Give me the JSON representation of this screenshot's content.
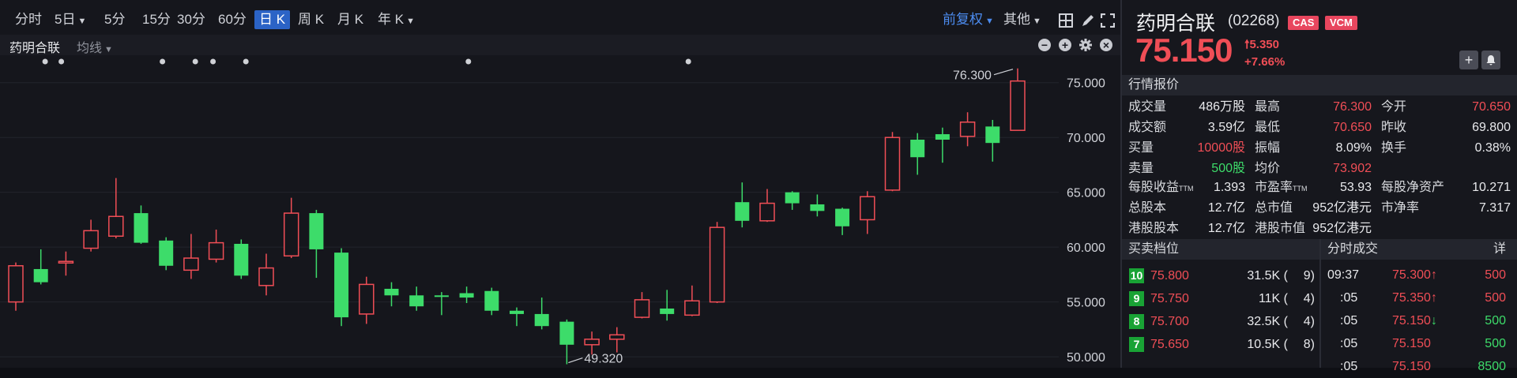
{
  "toolbar": {
    "periods": [
      {
        "label": "分时",
        "caret": false,
        "active": false
      },
      {
        "label": "5日",
        "caret": true,
        "active": false
      },
      {
        "label": "5分",
        "caret": false,
        "active": false
      },
      {
        "label": "15分",
        "caret": false,
        "active": false
      },
      {
        "label": "30分",
        "caret": false,
        "active": false
      },
      {
        "label": "60分",
        "caret": true,
        "active": false
      },
      {
        "label": "日 K",
        "caret": false,
        "active": true
      },
      {
        "label": "周 K",
        "caret": false,
        "active": false
      },
      {
        "label": "月 K",
        "caret": false,
        "active": false
      },
      {
        "label": "年 K",
        "caret": true,
        "active": false
      }
    ],
    "adjust_label": "前复权",
    "other_label": "其他"
  },
  "subbar": {
    "stock_label": "药明合联",
    "ma_label": "均线"
  },
  "chart_data": {
    "type": "candlestick",
    "y_ticks": [
      "75.000",
      "70.000",
      "65.000",
      "60.000",
      "55.000",
      "50.000"
    ],
    "ylim": [
      49.0,
      77.5
    ],
    "annotations": [
      {
        "text": "76.300",
        "value": 76.3
      },
      {
        "text": "49.320",
        "value": 49.32
      }
    ],
    "up_color": "#f04e56",
    "down_color": "#3ddc6a",
    "candles": [
      {
        "o": 55.0,
        "c": 58.3,
        "h": 58.6,
        "l": 54.2,
        "up": true
      },
      {
        "o": 58.0,
        "c": 56.8,
        "h": 59.8,
        "l": 56.6,
        "up": false
      },
      {
        "o": 58.6,
        "c": 58.7,
        "h": 59.6,
        "l": 57.4,
        "up": true
      },
      {
        "o": 59.9,
        "c": 61.5,
        "h": 62.5,
        "l": 59.6,
        "up": true
      },
      {
        "o": 61.0,
        "c": 62.8,
        "h": 66.3,
        "l": 60.8,
        "up": true
      },
      {
        "o": 63.1,
        "c": 60.4,
        "h": 63.8,
        "l": 60.3,
        "up": false
      },
      {
        "o": 60.6,
        "c": 58.3,
        "h": 60.9,
        "l": 57.9,
        "up": false
      },
      {
        "o": 57.9,
        "c": 59.0,
        "h": 61.2,
        "l": 57.1,
        "up": true
      },
      {
        "o": 58.9,
        "c": 60.4,
        "h": 61.6,
        "l": 58.6,
        "up": true
      },
      {
        "o": 60.3,
        "c": 57.4,
        "h": 60.7,
        "l": 57.1,
        "up": false
      },
      {
        "o": 56.5,
        "c": 58.1,
        "h": 59.4,
        "l": 55.6,
        "up": true
      },
      {
        "o": 59.2,
        "c": 63.1,
        "h": 64.5,
        "l": 59.0,
        "up": true
      },
      {
        "o": 63.1,
        "c": 59.8,
        "h": 63.4,
        "l": 57.2,
        "up": false
      },
      {
        "o": 59.5,
        "c": 53.6,
        "h": 59.9,
        "l": 52.8,
        "up": false
      },
      {
        "o": 53.9,
        "c": 56.6,
        "h": 57.3,
        "l": 53.0,
        "up": true
      },
      {
        "o": 56.2,
        "c": 55.6,
        "h": 56.8,
        "l": 54.6,
        "up": false
      },
      {
        "o": 55.6,
        "c": 54.6,
        "h": 56.4,
        "l": 54.2,
        "up": false
      },
      {
        "o": 55.6,
        "c": 55.5,
        "h": 55.9,
        "l": 53.8,
        "up": false
      },
      {
        "o": 55.8,
        "c": 55.4,
        "h": 56.4,
        "l": 54.9,
        "up": false
      },
      {
        "o": 56.0,
        "c": 54.2,
        "h": 56.3,
        "l": 53.8,
        "up": false
      },
      {
        "o": 54.2,
        "c": 53.9,
        "h": 54.5,
        "l": 52.8,
        "up": false
      },
      {
        "o": 53.9,
        "c": 52.8,
        "h": 55.4,
        "l": 52.5,
        "up": false
      },
      {
        "o": 53.2,
        "c": 51.1,
        "h": 53.4,
        "l": 49.32,
        "up": false
      },
      {
        "o": 51.1,
        "c": 51.6,
        "h": 52.3,
        "l": 50.2,
        "up": true
      },
      {
        "o": 51.6,
        "c": 52.0,
        "h": 52.7,
        "l": 50.4,
        "up": true
      },
      {
        "o": 53.6,
        "c": 55.2,
        "h": 55.9,
        "l": 53.5,
        "up": true
      },
      {
        "o": 54.4,
        "c": 53.9,
        "h": 56.1,
        "l": 53.3,
        "up": false
      },
      {
        "o": 53.8,
        "c": 55.1,
        "h": 56.5,
        "l": 53.7,
        "up": true
      },
      {
        "o": 55.0,
        "c": 61.8,
        "h": 62.3,
        "l": 54.9,
        "up": true
      },
      {
        "o": 64.1,
        "c": 62.4,
        "h": 65.9,
        "l": 61.8,
        "up": false
      },
      {
        "o": 62.4,
        "c": 64.0,
        "h": 65.3,
        "l": 62.3,
        "up": true
      },
      {
        "o": 65.0,
        "c": 64.0,
        "h": 65.1,
        "l": 63.4,
        "up": false
      },
      {
        "o": 63.9,
        "c": 63.3,
        "h": 64.8,
        "l": 62.8,
        "up": false
      },
      {
        "o": 63.5,
        "c": 61.9,
        "h": 63.6,
        "l": 61.1,
        "up": false
      },
      {
        "o": 62.5,
        "c": 64.6,
        "h": 65.1,
        "l": 61.2,
        "up": true
      },
      {
        "o": 65.2,
        "c": 70.0,
        "h": 70.5,
        "l": 65.1,
        "up": true
      },
      {
        "o": 69.8,
        "c": 68.2,
        "h": 70.4,
        "l": 66.6,
        "up": false
      },
      {
        "o": 70.3,
        "c": 69.8,
        "h": 70.9,
        "l": 67.7,
        "up": false
      },
      {
        "o": 70.1,
        "c": 71.4,
        "h": 72.3,
        "l": 69.2,
        "up": true
      },
      {
        "o": 71.0,
        "c": 69.5,
        "h": 71.6,
        "l": 67.8,
        "up": false
      },
      {
        "o": 70.65,
        "c": 75.15,
        "h": 76.3,
        "l": 70.65,
        "up": true
      }
    ]
  },
  "quote": {
    "name": "药明合联",
    "code": "(02268)",
    "tags": [
      "CAS",
      "VCM"
    ],
    "price": "75.150",
    "change": "5.350",
    "change_pct": "+7.66%"
  },
  "market_section": "行情报价",
  "stats_rows": [
    [
      {
        "k": "成交量",
        "v": "486万股",
        "c": "white"
      },
      {
        "k": "最高",
        "v": "76.300",
        "c": "red"
      },
      {
        "k": "今开",
        "v": "70.650",
        "c": "red"
      }
    ],
    [
      {
        "k": "成交额",
        "v": "3.59亿",
        "c": "white"
      },
      {
        "k": "最低",
        "v": "70.650",
        "c": "red"
      },
      {
        "k": "昨收",
        "v": "69.800",
        "c": "white"
      }
    ],
    [
      {
        "k": "买量",
        "v": "10000股",
        "c": "red"
      },
      {
        "k": "振幅",
        "v": "8.09%",
        "c": "white"
      },
      {
        "k": "换手",
        "v": "0.38%",
        "c": "white"
      }
    ],
    [
      {
        "k": "卖量",
        "v": "500股",
        "c": "green"
      },
      {
        "k": "均价",
        "v": "73.902",
        "c": "red"
      },
      {
        "k": "",
        "v": "",
        "c": "white"
      }
    ]
  ],
  "stats_rows2": [
    [
      {
        "k": "每股收益",
        "ttm": true,
        "v": "1.393",
        "c": "white"
      },
      {
        "k": "市盈率",
        "ttm": true,
        "v": "53.93",
        "c": "white"
      },
      {
        "k": "每股净资产",
        "ttm": false,
        "v": "10.271",
        "c": "white"
      }
    ],
    [
      {
        "k": "总股本",
        "ttm": false,
        "v": "12.7亿",
        "c": "white"
      },
      {
        "k": "总市值",
        "ttm": false,
        "v": "952亿港元",
        "c": "white"
      },
      {
        "k": "市净率",
        "ttm": false,
        "v": "7.317",
        "c": "white"
      }
    ],
    [
      {
        "k": "港股股本",
        "ttm": false,
        "v": "12.7亿",
        "c": "white"
      },
      {
        "k": "港股市值",
        "ttm": false,
        "v": "952亿港元",
        "c": "white"
      },
      {
        "k": "",
        "ttm": false,
        "v": "",
        "c": "white"
      }
    ]
  ],
  "ttm_label": "TTM",
  "orderbook": {
    "title": "买卖档位",
    "rows": [
      {
        "level": "10",
        "price": "75.800",
        "qty": "31.5K (",
        "orders": "9)"
      },
      {
        "level": "9",
        "price": "75.750",
        "qty": "11K (",
        "orders": "4)"
      },
      {
        "level": "8",
        "price": "75.700",
        "qty": "32.5K (",
        "orders": "4)"
      },
      {
        "level": "7",
        "price": "75.650",
        "qty": "10.5K (",
        "orders": "8)"
      }
    ]
  },
  "trades": {
    "title": "分时成交",
    "detail": "详",
    "rows": [
      {
        "time": "09:37",
        "price": "75.300",
        "dir": "up",
        "vol": "500",
        "vc": "red"
      },
      {
        "time": ":05",
        "price": "75.350",
        "dir": "up",
        "vol": "500",
        "vc": "red"
      },
      {
        "time": ":05",
        "price": "75.150",
        "dir": "down",
        "vol": "500",
        "vc": "green"
      },
      {
        "time": ":05",
        "price": "75.150",
        "dir": "",
        "vol": "500",
        "vc": "green"
      },
      {
        "time": ":05",
        "price": "75.150",
        "dir": "",
        "vol": "8500",
        "vc": "green"
      }
    ]
  }
}
